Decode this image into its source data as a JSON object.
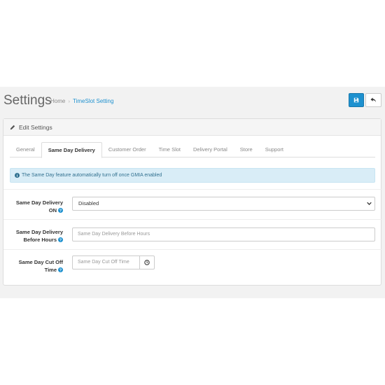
{
  "header": {
    "title": "Settings",
    "breadcrumb": {
      "home": "Home",
      "separator": "›",
      "current": "TimeSlot Setting"
    },
    "save_icon": "save-icon",
    "back_icon": "reply-icon"
  },
  "panel": {
    "heading": "Edit Settings",
    "heading_icon": "pencil-icon"
  },
  "tabs": [
    {
      "label": "General",
      "active": false
    },
    {
      "label": "Same Day Delivery",
      "active": true
    },
    {
      "label": "Customer Order",
      "active": false
    },
    {
      "label": "Time Slot",
      "active": false
    },
    {
      "label": "Delivery Portal",
      "active": false
    },
    {
      "label": "Store",
      "active": false
    },
    {
      "label": "Support",
      "active": false
    }
  ],
  "alert": {
    "text": "The Same Day feature automatically turn off once GMIA enabled",
    "icon": "info-circle-icon"
  },
  "form": {
    "same_day_on": {
      "label_line1": "Same Day Delivery",
      "label_line2": "ON",
      "value": "Disabled"
    },
    "before_hours": {
      "label_line1": "Same Day Delivery",
      "label_line2": "Before Hours",
      "placeholder": "Same Day Delivery Before Hours"
    },
    "cut_off": {
      "label_line1": "Same Day Cut Off",
      "label_line2": "Time",
      "placeholder": "Same Day Cut Off Time",
      "addon_icon": "clock-icon"
    }
  },
  "colors": {
    "primary": "#1e91cf",
    "alert_bg": "#d9edf7",
    "alert_text": "#31708f",
    "app_bg": "#f2f2f2"
  }
}
